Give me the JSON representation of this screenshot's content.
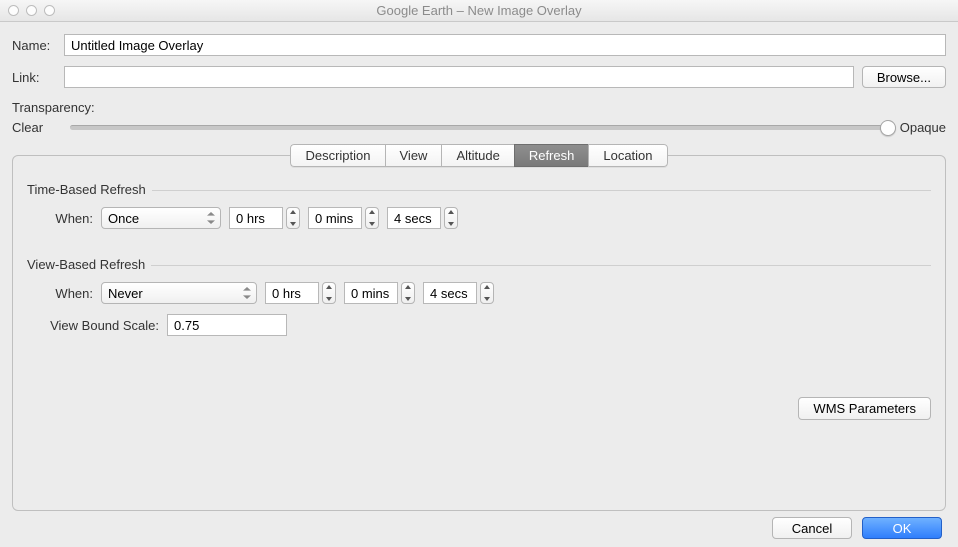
{
  "window": {
    "title": "Google Earth – New Image Overlay"
  },
  "topForm": {
    "nameLabel": "Name:",
    "nameValue": "Untitled Image Overlay",
    "linkLabel": "Link:",
    "linkValue": "",
    "browseLabel": "Browse..."
  },
  "transparency": {
    "heading": "Transparency:",
    "clearLabel": "Clear",
    "opaqueLabel": "Opaque"
  },
  "tabs": {
    "items": [
      "Description",
      "View",
      "Altitude",
      "Refresh",
      "Location"
    ],
    "active": "Refresh"
  },
  "refreshTab": {
    "timeSection": {
      "title": "Time-Based Refresh",
      "whenLabel": "When:",
      "whenValue": "Once",
      "hrs": "0 hrs",
      "mins": "0 mins",
      "secs": "4 secs"
    },
    "viewSection": {
      "title": "View-Based Refresh",
      "whenLabel": "When:",
      "whenValue": "Never",
      "hrs": "0 hrs",
      "mins": "0 mins",
      "secs": "4 secs",
      "boundScaleLabel": "View Bound Scale:",
      "boundScaleValue": "0.75"
    },
    "wmsButton": "WMS Parameters"
  },
  "footer": {
    "cancel": "Cancel",
    "ok": "OK"
  }
}
